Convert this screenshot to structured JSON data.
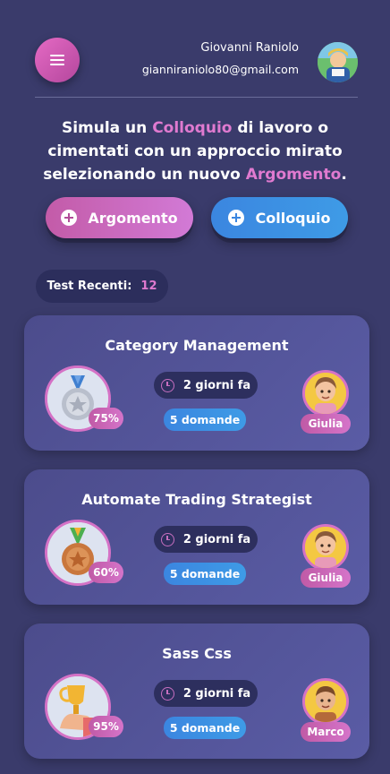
{
  "header": {
    "user_name": "Giovanni Raniolo",
    "user_email": "gianniraniolo80@gmail.com"
  },
  "intro": {
    "part1": "Simula un ",
    "hl1": "Colloquio",
    "part2": " di lavoro o cimentati con un approccio mirato selezionando un nuovo ",
    "hl2": "Argomento",
    "part3": "."
  },
  "buttons": {
    "argomento_label": "Argomento",
    "colloquio_label": "Colloquio"
  },
  "recent": {
    "label": "Test Recenti:",
    "count": "12"
  },
  "tests": [
    {
      "title": "Category Management",
      "percent": "75%",
      "medal": "silver-medal-icon",
      "time": "2 giorni fa",
      "questions": "5 domande",
      "person": "Giulia"
    },
    {
      "title": "Automate Trading Strategist",
      "percent": "60%",
      "medal": "bronze-medal-icon",
      "time": "2 giorni fa",
      "questions": "5 domande",
      "person": "Giulia"
    },
    {
      "title": "Sass Css",
      "percent": "95%",
      "medal": "trophy-icon",
      "time": "2 giorni fa",
      "questions": "5 domande",
      "person": "Marco"
    }
  ],
  "colors": {
    "background": "#3a3b6b",
    "accent_pink": "#e07ad0",
    "accent_blue": "#3b86e0"
  }
}
